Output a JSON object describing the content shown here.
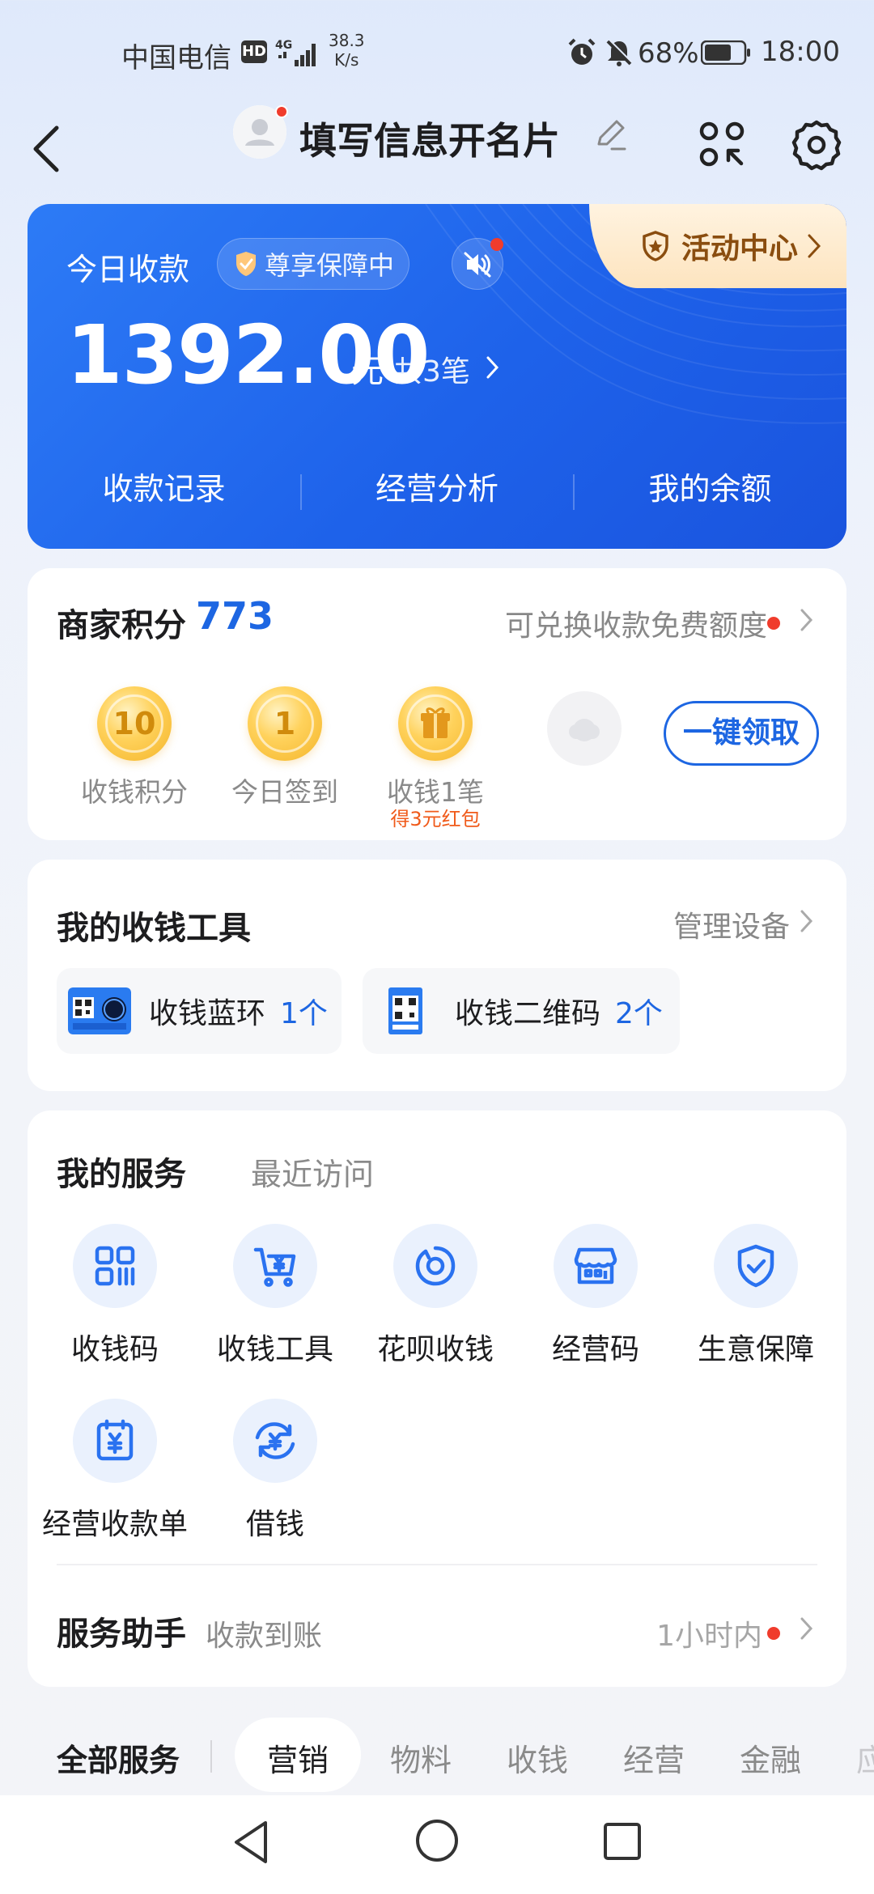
{
  "status_bar": {
    "carrier": "中国电信",
    "hd": "HD",
    "network": "4G",
    "speed_value": "38.3",
    "speed_unit": "K/s",
    "battery_percent": "68%",
    "time": "18:00"
  },
  "header": {
    "title": "填写信息开名片"
  },
  "income_card": {
    "label": "今日收款",
    "badge": "尊享保障中",
    "activity": "活动中心",
    "amount": "1392.00",
    "unit": "元",
    "count": "共3笔",
    "links": [
      "收款记录",
      "经营分析",
      "我的余额"
    ]
  },
  "points": {
    "title": "商家积分",
    "value": "773",
    "exchange": "可兑换收款免费额度",
    "items": [
      {
        "coin": "10",
        "label": "收钱积分",
        "sub": ""
      },
      {
        "coin": "1",
        "label": "今日签到",
        "sub": ""
      },
      {
        "coin": "",
        "label": "收钱1笔",
        "sub": "得3元红包"
      }
    ],
    "claim": "一键领取"
  },
  "tools": {
    "title": "我的收钱工具",
    "manage": "管理设备",
    "items": [
      {
        "name": "收钱蓝环",
        "count": "1个"
      },
      {
        "name": "收钱二维码",
        "count": "2个"
      }
    ]
  },
  "services": {
    "tabs": [
      "我的服务",
      "最近访问"
    ],
    "items": [
      {
        "label": "收钱码",
        "icon": "qrcode-icon"
      },
      {
        "label": "收钱工具",
        "icon": "cart-icon"
      },
      {
        "label": "花呗收钱",
        "icon": "huabei-icon"
      },
      {
        "label": "经营码",
        "icon": "store-icon"
      },
      {
        "label": "生意保障",
        "icon": "shield-icon"
      },
      {
        "label": "经营收款单",
        "icon": "bill-icon"
      },
      {
        "label": "借钱",
        "icon": "loan-icon"
      }
    ],
    "helper": {
      "title": "服务助手",
      "subtitle": "收款到账",
      "time": "1小时内"
    }
  },
  "categories": {
    "all": "全部服务",
    "items": [
      "营销",
      "物料",
      "收钱",
      "经营",
      "金融",
      "应"
    ]
  },
  "colors": {
    "brand_blue": "#1e62ea",
    "accent_blue": "#1d66e2",
    "alert_red": "#f03c2c",
    "activity_brown": "#8a4d0f"
  }
}
